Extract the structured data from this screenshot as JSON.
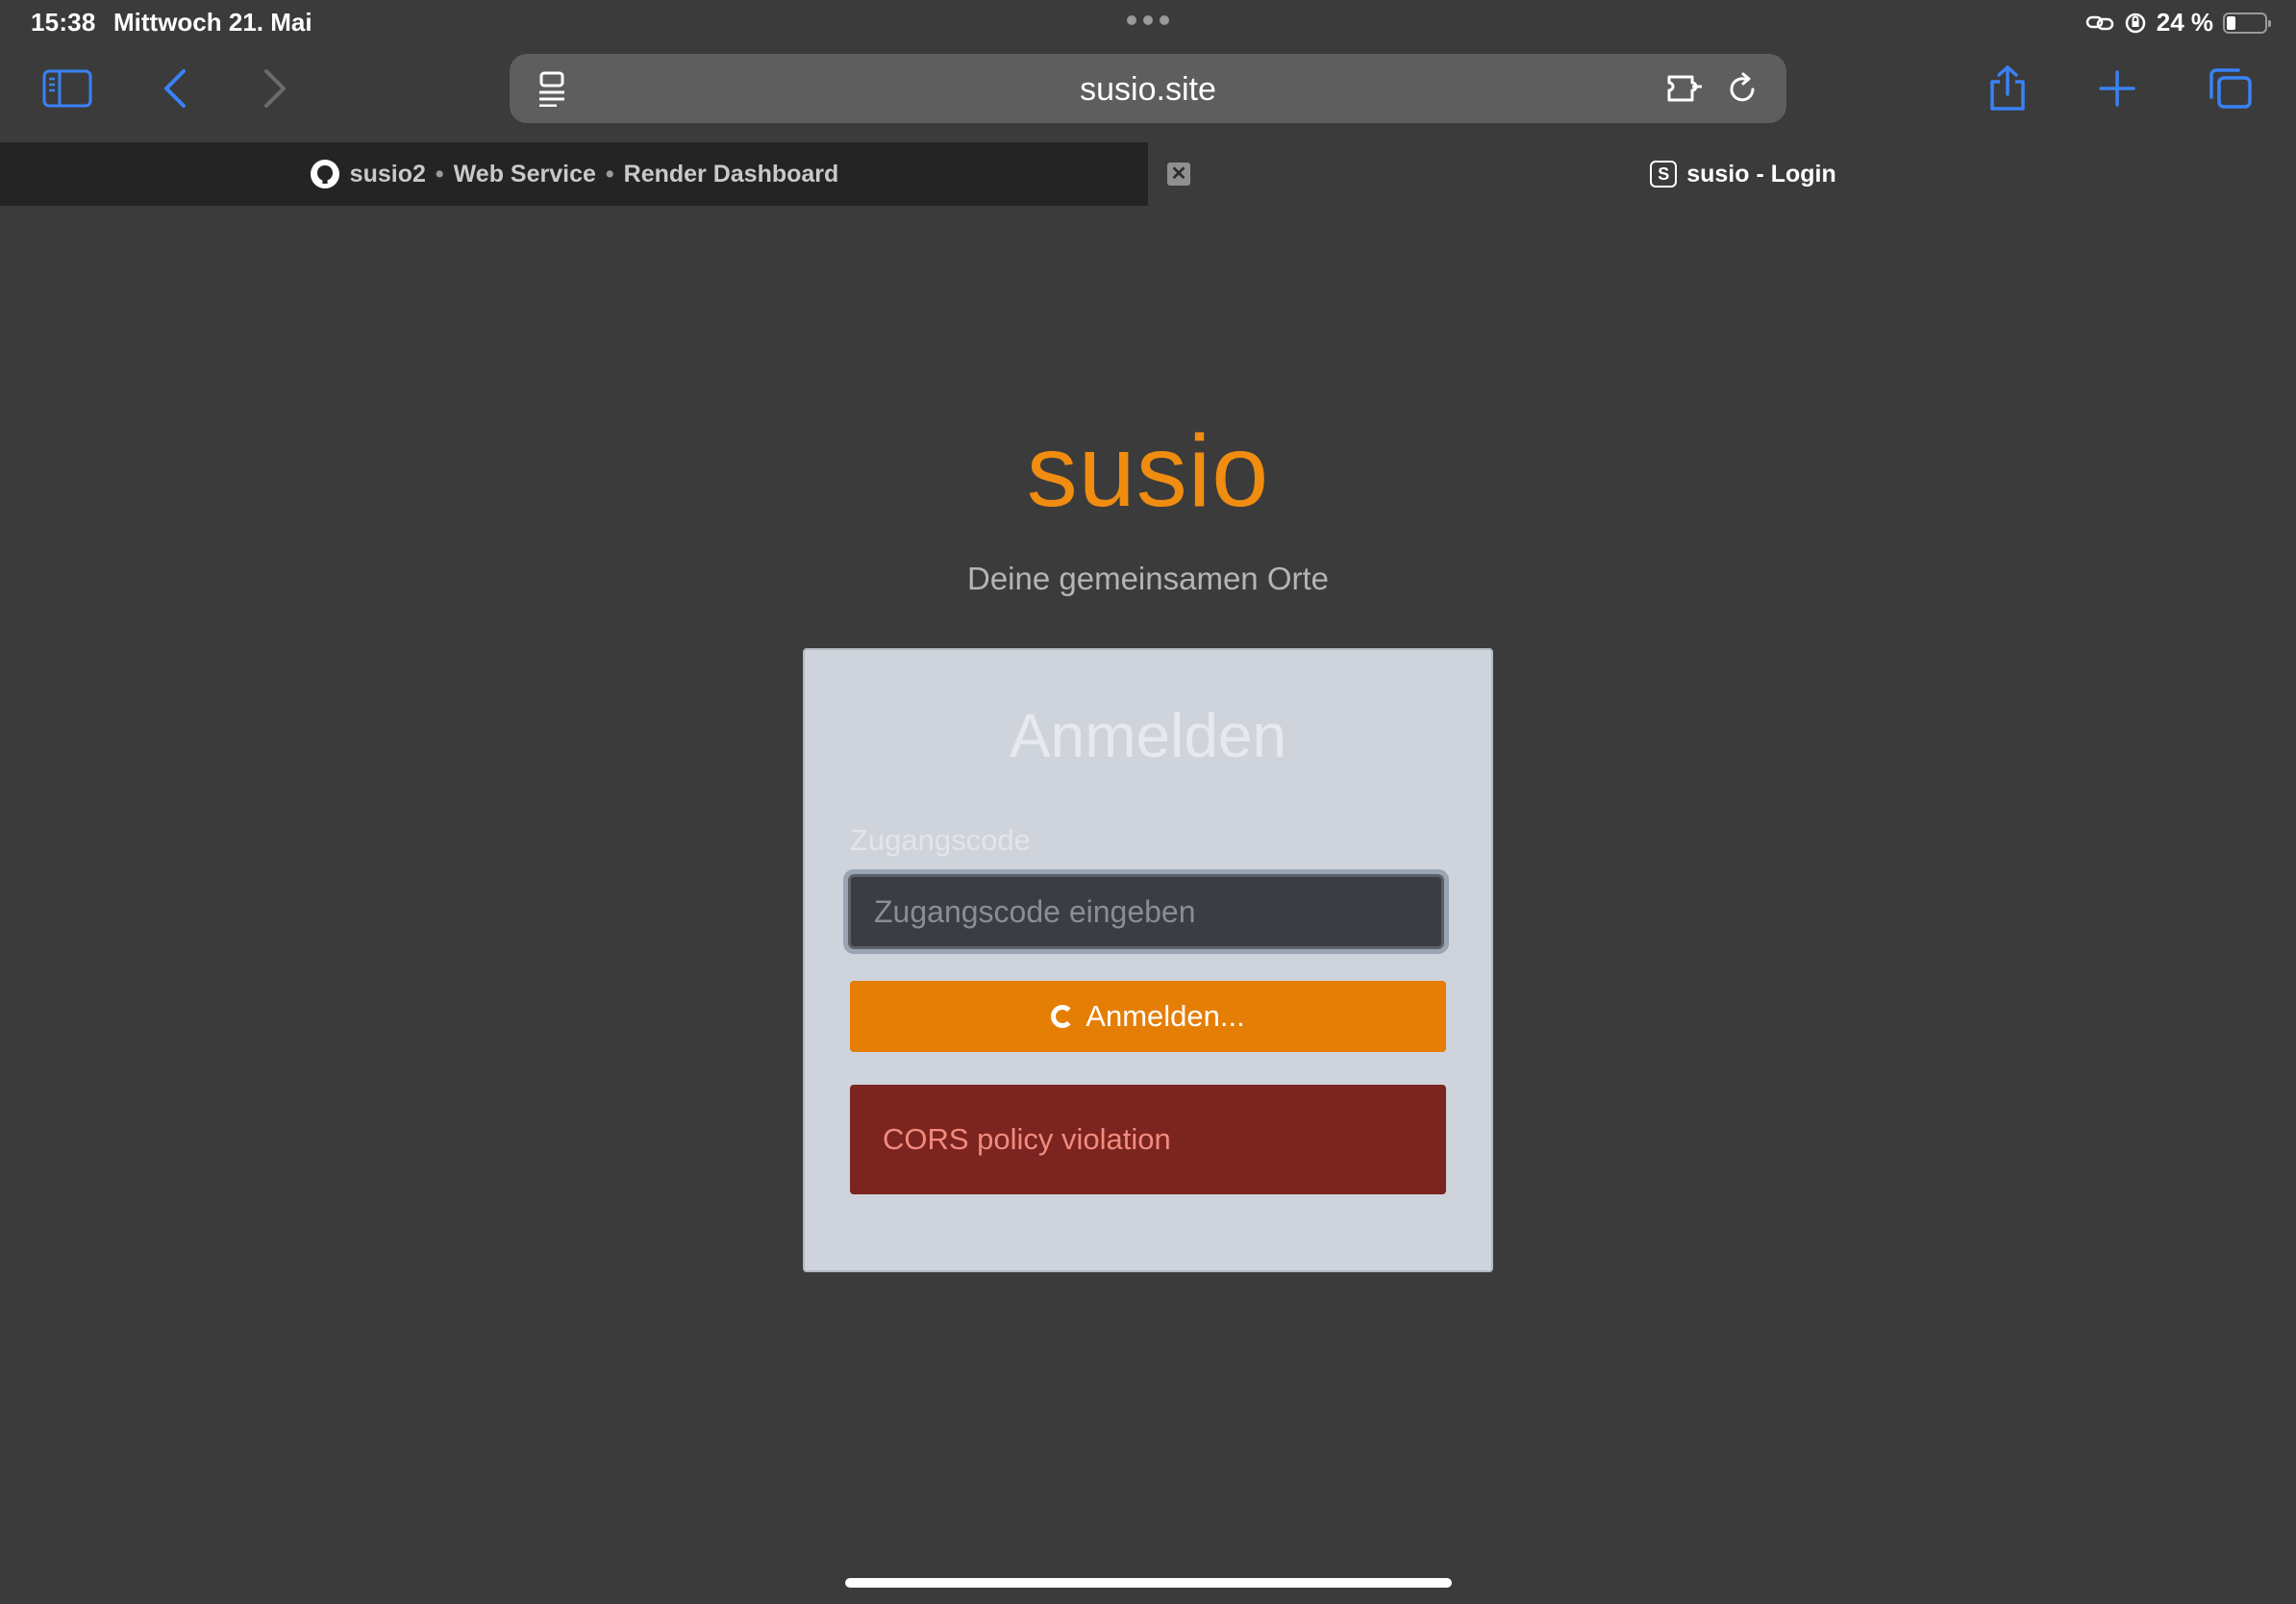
{
  "status_bar": {
    "time": "15:38",
    "date": "Mittwoch 21. Mai",
    "battery": "24 %",
    "battery_level": 0.24
  },
  "browser": {
    "url": "susio.site",
    "tabs": [
      {
        "label_parts": [
          "susio2",
          "Web Service",
          "Render Dashboard"
        ],
        "separator": "•",
        "icon": "github-icon",
        "active": false
      },
      {
        "label": "susio - Login",
        "icon_letter": "S",
        "active": true
      }
    ],
    "close_glyph": "✕"
  },
  "page": {
    "brand": "susio",
    "tagline": "Deine gemeinsamen Orte",
    "login": {
      "title": "Anmelden",
      "field_label": "Zugangscode",
      "placeholder": "Zugangscode eingeben",
      "button_label": "Anmelden...",
      "error": "CORS policy violation"
    }
  },
  "colors": {
    "accent": "#f08c0f",
    "button": "#e57e04",
    "error_bg": "#7b2420",
    "error_text": "#f28b7e",
    "toolbar_icon": "#3a82f7"
  }
}
